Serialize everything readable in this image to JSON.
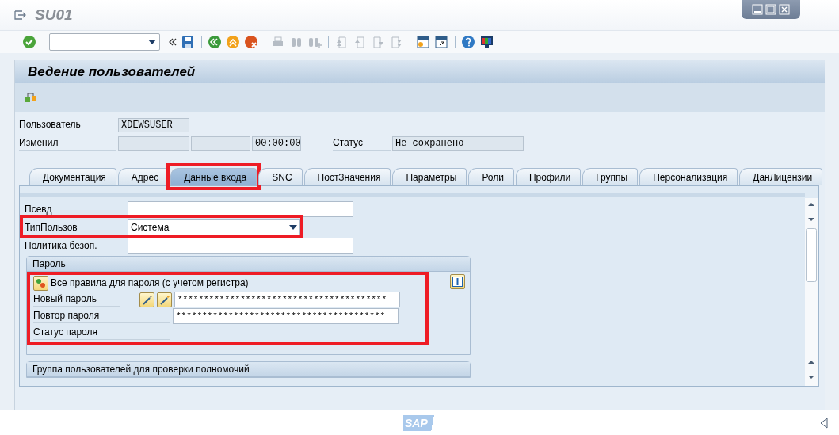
{
  "window": {
    "title": "SU01"
  },
  "screen": {
    "title": "Ведение пользователей"
  },
  "header": {
    "user": {
      "label": "Пользователь",
      "value": "XDEWSUSER"
    },
    "changed_by": {
      "label": "Изменил",
      "time": "00:00:00"
    },
    "status": {
      "label": "Статус",
      "value": "Не сохранено"
    }
  },
  "tabs": [
    {
      "label": "Документация",
      "selected": false,
      "highlighted": false
    },
    {
      "label": "Адрес",
      "selected": false,
      "highlighted": false
    },
    {
      "label": "Данные входа",
      "selected": true,
      "highlighted": true
    },
    {
      "label": "SNC",
      "selected": false,
      "highlighted": false
    },
    {
      "label": "ПостЗначения",
      "selected": false,
      "highlighted": false
    },
    {
      "label": "Параметры",
      "selected": false,
      "highlighted": false
    },
    {
      "label": "Роли",
      "selected": false,
      "highlighted": false
    },
    {
      "label": "Профили",
      "selected": false,
      "highlighted": false
    },
    {
      "label": "Группы",
      "selected": false,
      "highlighted": false
    },
    {
      "label": "Персонализация",
      "selected": false,
      "highlighted": false
    },
    {
      "label": "ДанЛицензии",
      "selected": false,
      "highlighted": false
    }
  ],
  "logon_data": {
    "fields": [
      {
        "label": "Псевд",
        "kind": "text",
        "highlighted": false
      },
      {
        "label": "ТипПользов",
        "kind": "dropdown",
        "value": "Система",
        "highlighted": true
      },
      {
        "label": "Политика безоп.",
        "kind": "text",
        "highlighted": false
      }
    ],
    "password_group": {
      "title": "Пароль",
      "highlighted": true,
      "rules_text": "Все правила для пароля (с учетом регистра)",
      "new_password": {
        "label": "Новый пароль",
        "value": "****************************************"
      },
      "repeat_password": {
        "label": "Повтор пароля",
        "value": "****************************************"
      },
      "status_label": "Статус пароля"
    },
    "auth_group": {
      "title": "Группа пользователей для проверки полномочий"
    }
  },
  "footer": {
    "logo": "SAP"
  }
}
